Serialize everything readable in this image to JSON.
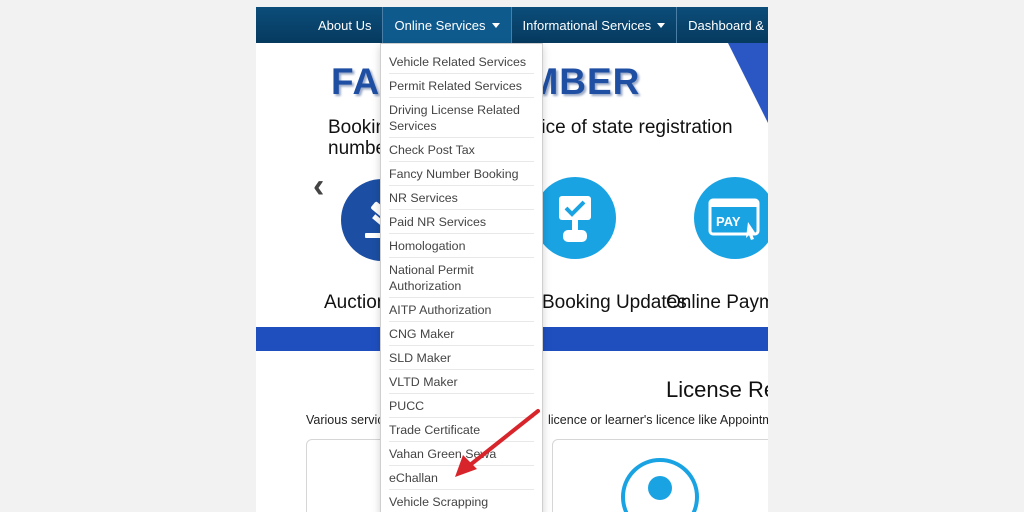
{
  "nav": {
    "items": [
      "About Us",
      "Online Services",
      "Informational Services",
      "Dashboard & Reports"
    ]
  },
  "banner": {
    "title": "FANCY NUMBER",
    "tagline": "Booking of fancy and choice of state registration numbers made easy"
  },
  "features": [
    {
      "caption": "Auction",
      "icon": "gavel-icon"
    },
    {
      "caption": "Booking Updates",
      "icon": "checkmark-sign-icon"
    },
    {
      "caption": "Online Payment",
      "icon": "pay-screen-icon",
      "icon_text": "PAY"
    }
  ],
  "license": {
    "title": "License Related Services",
    "description_left": "Various services",
    "description_right": "licence or learner's licence like Appointment"
  },
  "dropdown": {
    "items": [
      "Vehicle Related Services",
      "Permit Related Services",
      "Driving License Related Services",
      "Check Post Tax",
      "Fancy Number Booking",
      "NR Services",
      "Paid NR Services",
      "Homologation",
      "National Permit Authorization",
      "AITP Authorization",
      "CNG Maker",
      "SLD Maker",
      "VLTD Maker",
      "PUCC",
      "Trade Certificate",
      "Vahan Green Sewa",
      "eChallan",
      "Vehicle Scrapping"
    ]
  },
  "colors": {
    "nav_bg": "#0b4d7a",
    "brand_blue": "#1f4fa3",
    "accent_cyan": "#1aa3e3",
    "annotation_red": "#d8252b"
  }
}
